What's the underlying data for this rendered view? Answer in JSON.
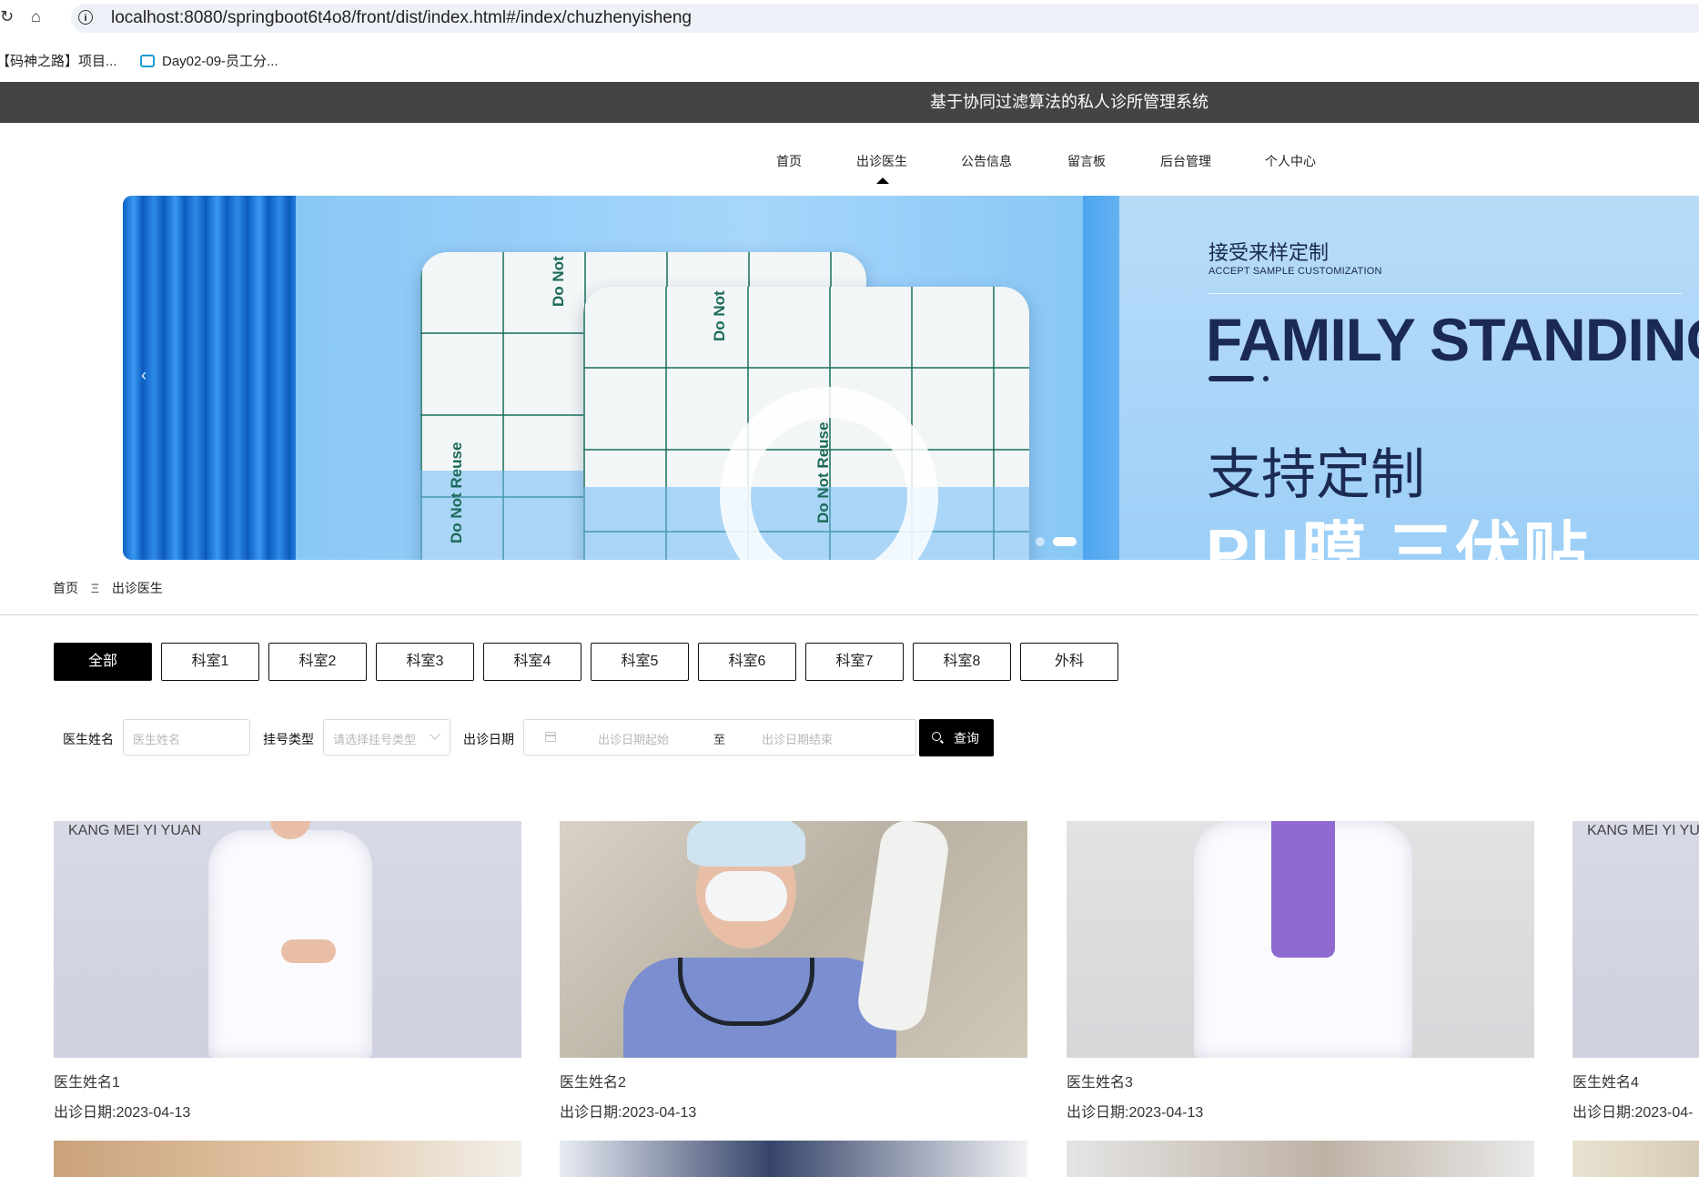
{
  "browser": {
    "url": "localhost:8080/springboot6t4o8/front/dist/index.html#/index/chuzhenyisheng",
    "bookmarks": [
      "【码神之路】项目...",
      "Day02-09-员工分..."
    ]
  },
  "site": {
    "title": "基于协同过滤算法的私人诊所管理系统",
    "nav": [
      "首页",
      "出诊医生",
      "公告信息",
      "留言板",
      "后台管理",
      "个人中心"
    ],
    "active_nav": "出诊医生"
  },
  "banner": {
    "accept_cn": "接受来样定制",
    "accept_en": "ACCEPT SAMPLE CUSTOMIZATION",
    "headline": "FAMILY STANDING",
    "support": "支持定制",
    "product": "PU膜 三伏贴",
    "patch_text": "Do Not Reuse",
    "prev_arrow": "‹"
  },
  "breadcrumb": {
    "home": "首页",
    "separator": "Ξ",
    "current": "出诊医生"
  },
  "categories": [
    "全部",
    "科室1",
    "科室2",
    "科室3",
    "科室4",
    "科室5",
    "科室6",
    "科室7",
    "科室8",
    "外科"
  ],
  "active_category": "全部",
  "search": {
    "name_label": "医生姓名",
    "name_placeholder": "医生姓名",
    "type_label": "挂号类型",
    "type_placeholder": "请选择挂号类型",
    "date_label": "出诊日期",
    "date_start_placeholder": "出诊日期起始",
    "date_to": "至",
    "date_end_placeholder": "出诊日期结束",
    "button": "查询"
  },
  "doctors": [
    {
      "name": "医生姓名1",
      "date": "出诊日期:2023-04-13",
      "watermark": "KANG MEI YI YUAN"
    },
    {
      "name": "医生姓名2",
      "date": "出诊日期:2023-04-13",
      "watermark": ""
    },
    {
      "name": "医生姓名3",
      "date": "出诊日期:2023-04-13",
      "watermark": ""
    },
    {
      "name": "医生姓名4",
      "date": "出诊日期:2023-04-",
      "watermark": "KANG MEI YI YUA"
    }
  ],
  "colors": {
    "header_bg": "#444444",
    "active_black": "#000000",
    "banner_blue": "#7ec2f4",
    "headline_navy": "#1b2a52"
  }
}
